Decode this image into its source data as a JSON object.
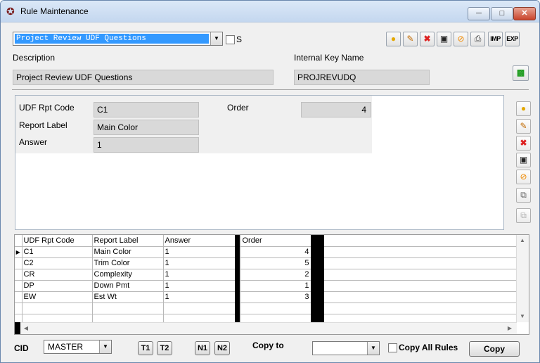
{
  "window": {
    "title": "Rule Maintenance",
    "icon": "star-icon"
  },
  "top": {
    "rule_select_value": "Project Review UDF Questions",
    "s_label": "S",
    "description_label": "Description",
    "description_value": "Project Review UDF Questions",
    "key_label": "Internal Key Name",
    "key_value": "PROJREVUDQ",
    "toolbar": {
      "imp_label": "IMP",
      "exp_label": "EXP"
    }
  },
  "detail": {
    "code_label": "UDF Rpt Code",
    "code_value": "C1",
    "report_label_label": "Report Label",
    "report_label_value": "Main Color",
    "answer_label": "Answer",
    "answer_value": "1",
    "order_label": "Order",
    "order_value": "4"
  },
  "grid": {
    "headers": [
      "UDF Rpt Code",
      "Report Label",
      "Answer",
      "Order"
    ],
    "rows": [
      {
        "code": "C1",
        "label": "Main Color",
        "answer": "1",
        "order": "4"
      },
      {
        "code": "C2",
        "label": "Trim Color",
        "answer": "1",
        "order": "5"
      },
      {
        "code": "CR",
        "label": "Complexity",
        "answer": "1",
        "order": "2"
      },
      {
        "code": "DP",
        "label": "Down Pmt",
        "answer": "1",
        "order": "1"
      },
      {
        "code": "EW",
        "label": "Est Wt",
        "answer": "1",
        "order": "3"
      }
    ]
  },
  "footer": {
    "cid_label": "CID",
    "cid_value": "MASTER",
    "t1": "T1",
    "t2": "T2",
    "n1": "N1",
    "n2": "N2",
    "copy_to_label": "Copy to",
    "copy_to_value": "",
    "copy_all_label": "Copy All Rules",
    "copy_button": "Copy"
  }
}
